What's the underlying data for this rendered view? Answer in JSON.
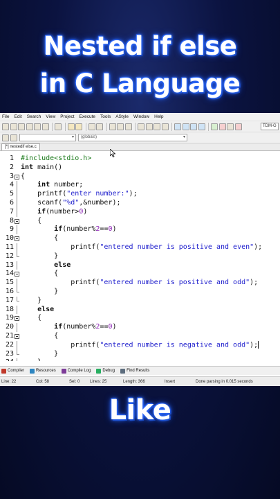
{
  "headline": {
    "line1": "Nested if else",
    "line2": "in C Language"
  },
  "footer_text": "Like",
  "menu": [
    "File",
    "Edit",
    "Search",
    "View",
    "Project",
    "Execute",
    "Tools",
    "AStyle",
    "Window",
    "Help"
  ],
  "toolbar": {
    "compiler_combo": "TDM-G"
  },
  "scope_select": "(globals)",
  "tab": {
    "label": "[*] nestedif else.c"
  },
  "code_lines": [
    {
      "n": "1",
      "fold": "",
      "indent": "",
      "text": "#include<stdio.h>"
    },
    {
      "n": "2",
      "fold": "",
      "indent": "",
      "text": "int main()"
    },
    {
      "n": "3",
      "fold": "open",
      "indent": "",
      "text": "{"
    },
    {
      "n": "4",
      "fold": "line",
      "indent": "    ",
      "text": "int number;"
    },
    {
      "n": "5",
      "fold": "line",
      "indent": "    ",
      "text": "printf(\"enter number:\");"
    },
    {
      "n": "6",
      "fold": "line",
      "indent": "    ",
      "text": "scanf(\"%d\",&number);"
    },
    {
      "n": "7",
      "fold": "line",
      "indent": "    ",
      "text": "if(number>0)"
    },
    {
      "n": "8",
      "fold": "open",
      "indent": "    ",
      "text": "{"
    },
    {
      "n": "9",
      "fold": "line",
      "indent": "        ",
      "text": "if(number%2==0)"
    },
    {
      "n": "10",
      "fold": "open",
      "indent": "        ",
      "text": "{"
    },
    {
      "n": "11",
      "fold": "line",
      "indent": "            ",
      "text": "printf(\"entered number is positive and even\");"
    },
    {
      "n": "12",
      "fold": "end",
      "indent": "        ",
      "text": "}"
    },
    {
      "n": "13",
      "fold": "line",
      "indent": "        ",
      "text": "else"
    },
    {
      "n": "14",
      "fold": "open",
      "indent": "        ",
      "text": "{"
    },
    {
      "n": "15",
      "fold": "line",
      "indent": "            ",
      "text": "printf(\"entered number is positive and odd\");"
    },
    {
      "n": "16",
      "fold": "end",
      "indent": "        ",
      "text": "}"
    },
    {
      "n": "17",
      "fold": "end",
      "indent": "    ",
      "text": "}"
    },
    {
      "n": "18",
      "fold": "line",
      "indent": "    ",
      "text": "else"
    },
    {
      "n": "19",
      "fold": "open",
      "indent": "    ",
      "text": "{"
    },
    {
      "n": "20",
      "fold": "line",
      "indent": "        ",
      "text": "if(number%2==0)"
    },
    {
      "n": "21",
      "fold": "open",
      "indent": "        ",
      "text": "{"
    },
    {
      "n": "22",
      "fold": "line",
      "indent": "            ",
      "text": "printf(\"entered number is negative and odd\");"
    },
    {
      "n": "23",
      "fold": "end",
      "indent": "        ",
      "text": "}"
    },
    {
      "n": "24",
      "fold": "line",
      "indent": "    ",
      "text": "}"
    }
  ],
  "bottom_tabs": [
    {
      "label": "Compiler",
      "icon": "compiler-icon",
      "color": "#c0392b"
    },
    {
      "label": "Resources",
      "icon": "resources-icon",
      "color": "#2e86c1"
    },
    {
      "label": "Compile Log",
      "icon": "compile-log-icon",
      "color": "#7d3c98"
    },
    {
      "label": "Debug",
      "icon": "debug-icon",
      "color": "#27ae60"
    },
    {
      "label": "Find Results",
      "icon": "find-results-icon",
      "color": "#5d6d7e"
    }
  ],
  "status": {
    "line": "Line:   22",
    "col": "Col:   58",
    "sel": "Sel:   0",
    "lines": "Lines:   25",
    "length": "Length:   366",
    "mode": "Insert",
    "message": "Done parsing in 0.015 seconds"
  },
  "colors": {
    "string": "#1b1bcc",
    "number": "#8a1fb5",
    "preprocessor": "#1a7a1a",
    "title_glow": "#2f6cff"
  }
}
